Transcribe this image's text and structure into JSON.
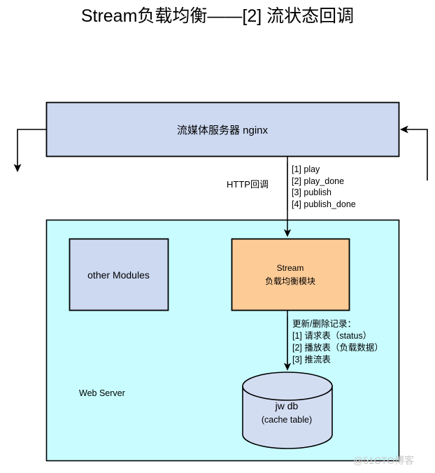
{
  "title": "Stream负载均衡——[2] 流状态回调",
  "colors": {
    "nginx_fill": "#ccd9f1",
    "module_fill": "#fdcb96",
    "container_fill": "#c8fcff",
    "db_fill": "#d3ddf2",
    "stroke": "#000000",
    "watermark": "#c9c9c9"
  },
  "nodes": {
    "nginx": {
      "label": "流媒体服务器 nginx"
    },
    "other_modules": {
      "label": "other Modules"
    },
    "stream_module": {
      "line1": "Stream",
      "line2": "负载均衡模块"
    },
    "database": {
      "line1": "jw db",
      "line2": "(cache table)"
    },
    "container": {
      "label": "Web Server"
    }
  },
  "edges": {
    "http_callback": {
      "label": "HTTP回调",
      "items": [
        "[1] play",
        "[2] play_done",
        "[3] publish",
        "[4] publish_done"
      ]
    },
    "db_operations": {
      "label": "更新/删除记录：",
      "items": [
        "[1] 请求表（status）",
        "[2] 播放表（负载数据）",
        "[3] 推流表"
      ]
    }
  },
  "watermark": "@51CTO博客"
}
